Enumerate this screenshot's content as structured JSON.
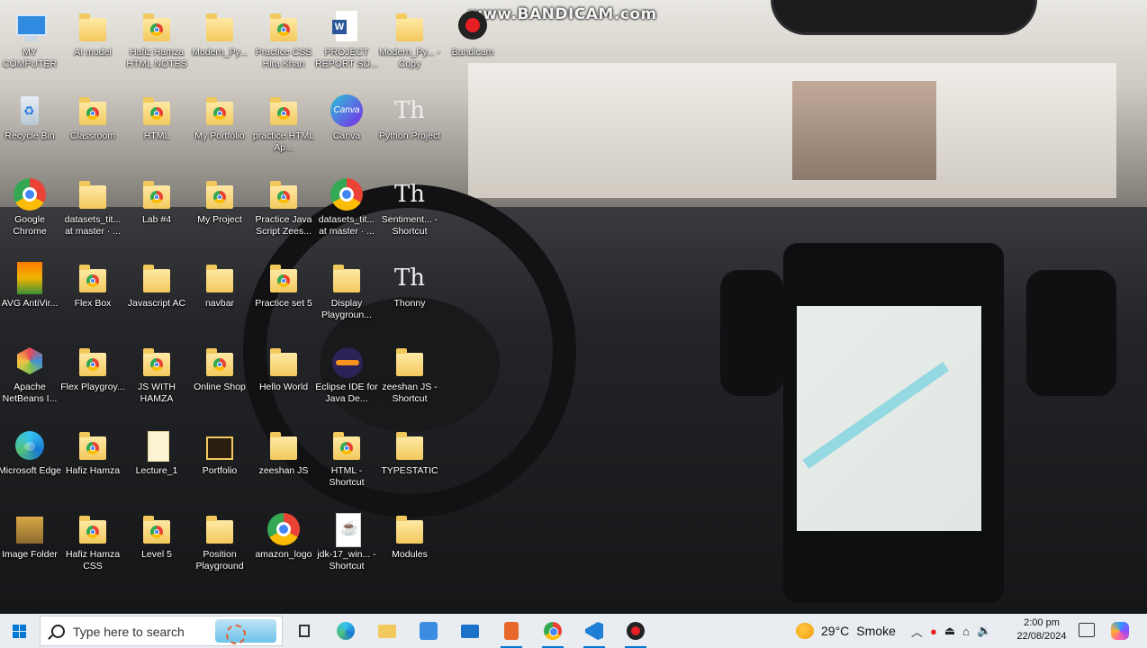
{
  "watermark": "www.BANDICAM.com",
  "desktop_icons": [
    {
      "label": "MY COMPUTER",
      "icon": "computer-icon"
    },
    {
      "label": "AI model",
      "icon": "folder-icon"
    },
    {
      "label": "Hafiz Hamza HTML NOTES",
      "icon": "chrome-folder-icon"
    },
    {
      "label": "Modern_Py...",
      "icon": "folder-icon"
    },
    {
      "label": "Practice CSS Hira Khan",
      "icon": "chrome-folder-icon"
    },
    {
      "label": "PROJECT REPORT SD...",
      "icon": "word-icon"
    },
    {
      "label": "Modern_Py... - Copy",
      "icon": "folder-icon"
    },
    {
      "label": "Bandicam",
      "icon": "bandicam-icon"
    },
    {
      "label": "Recycle Bin",
      "icon": "recycle-bin-icon"
    },
    {
      "label": "Classroom",
      "icon": "chrome-folder-icon"
    },
    {
      "label": "HTML",
      "icon": "chrome-folder-icon"
    },
    {
      "label": "My Portfolio",
      "icon": "chrome-folder-icon"
    },
    {
      "label": "practice HTML Ap...",
      "icon": "chrome-folder-icon"
    },
    {
      "label": "Canva",
      "icon": "canva-icon"
    },
    {
      "label": "Python Project",
      "icon": "thonny-icon"
    },
    {
      "label": "Google Chrome",
      "icon": "chrome-icon"
    },
    {
      "label": "datasets_tit... at master · ...",
      "icon": "folder-icon"
    },
    {
      "label": "Lab #4",
      "icon": "chrome-folder-icon"
    },
    {
      "label": "My Project",
      "icon": "chrome-folder-icon"
    },
    {
      "label": "Practice Java Script Zees...",
      "icon": "chrome-folder-icon"
    },
    {
      "label": "datasets_tit... at master · ...",
      "icon": "chrome-icon"
    },
    {
      "label": "Sentiment... - Shortcut",
      "icon": "thonny-icon"
    },
    {
      "label": "AVG AntiVir...",
      "icon": "avg-icon"
    },
    {
      "label": "Flex Box",
      "icon": "chrome-folder-icon"
    },
    {
      "label": "Javascript AC",
      "icon": "folder-icon"
    },
    {
      "label": "navbar",
      "icon": "folder-icon"
    },
    {
      "label": "Practice set 5",
      "icon": "chrome-folder-icon"
    },
    {
      "label": "Display Playgroun...",
      "icon": "folder-icon"
    },
    {
      "label": "Thonny",
      "icon": "thonny-icon"
    },
    {
      "label": "Apache NetBeans I...",
      "icon": "netbeans-icon"
    },
    {
      "label": "Flex Playgroy...",
      "icon": "chrome-folder-icon"
    },
    {
      "label": "JS WITH HAMZA",
      "icon": "chrome-folder-icon"
    },
    {
      "label": "Online Shop",
      "icon": "chrome-folder-icon"
    },
    {
      "label": "Hello World",
      "icon": "folder-icon"
    },
    {
      "label": "Eclipse IDE for Java De...",
      "icon": "eclipse-icon"
    },
    {
      "label": "zeeshan JS - Shortcut",
      "icon": "folder-icon"
    },
    {
      "label": "Microsoft Edge",
      "icon": "edge-icon"
    },
    {
      "label": "Hafiz Hamza",
      "icon": "chrome-folder-icon"
    },
    {
      "label": "Lecture_1",
      "icon": "document-icon"
    },
    {
      "label": "Portfolio",
      "icon": "portfolio-folder-icon"
    },
    {
      "label": "zeeshan JS",
      "icon": "folder-icon"
    },
    {
      "label": "HTML - Shortcut",
      "icon": "chrome-folder-icon"
    },
    {
      "label": "TYPESTATIC",
      "icon": "folder-icon"
    },
    {
      "label": "Image Folder",
      "icon": "image-folder-icon"
    },
    {
      "label": "Hafiz Hamza CSS",
      "icon": "chrome-folder-icon"
    },
    {
      "label": "Level 5",
      "icon": "chrome-folder-icon"
    },
    {
      "label": "Position Playground",
      "icon": "folder-icon"
    },
    {
      "label": "amazon_logo",
      "icon": "chrome-icon"
    },
    {
      "label": "jdk-17_win... - Shortcut",
      "icon": "java-icon"
    },
    {
      "label": "Modules",
      "icon": "folder-icon"
    }
  ],
  "taskbar": {
    "search_placeholder": "Type here to search",
    "weather_temp": "29°C",
    "weather_desc": "Smoke",
    "time": "2:00 pm",
    "date": "22/08/2024",
    "pinned": [
      "task-view-icon",
      "edge-icon",
      "file-explorer-icon",
      "store-icon",
      "mail-icon",
      "xd-icon",
      "chrome-icon",
      "vscode-icon",
      "bandicam-record-icon"
    ]
  },
  "colors": {
    "accent": "#0078d4",
    "taskbar_bg": "#e9edf1"
  }
}
